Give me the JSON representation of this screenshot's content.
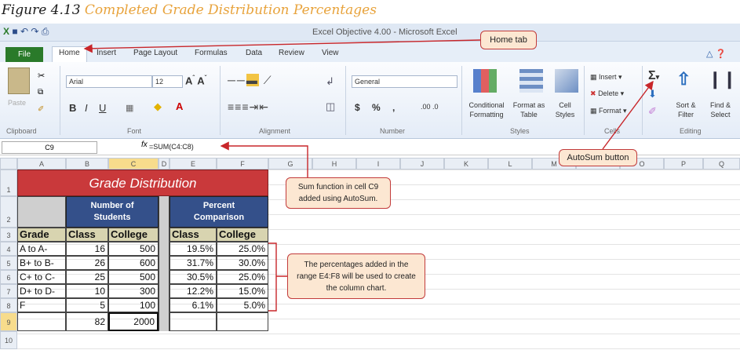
{
  "figure": {
    "label": "Figure 4.13",
    "caption": "Completed Grade Distribution Percentages"
  },
  "window": {
    "title": "Excel Objective 4.00 - Microsoft Excel"
  },
  "tabs": [
    "File",
    "Home",
    "Insert",
    "Page Layout",
    "Formulas",
    "Data",
    "Review",
    "View"
  ],
  "ribbon": {
    "clipboard": {
      "paste": "Paste",
      "group": "Clipboard"
    },
    "font": {
      "name": "Arial",
      "size": "12",
      "group": "Font"
    },
    "alignment": {
      "group": "Alignment"
    },
    "number": {
      "format": "General",
      "group": "Number"
    },
    "styles": {
      "conditional": "Conditional\nFormatting",
      "format_table": "Format as\nTable",
      "cell_styles": "Cell\nStyles",
      "group": "Styles"
    },
    "cells": {
      "insert": "Insert",
      "delete": "Delete",
      "format": "Format",
      "group": "Cells"
    },
    "editing": {
      "sort": "Sort &\nFilter",
      "find": "Find &\nSelect",
      "group": "Editing"
    }
  },
  "formula_bar": {
    "name_box": "C9",
    "fx": "fx",
    "formula": "=SUM(C4:C8)"
  },
  "columns": [
    "A",
    "B",
    "C",
    "D",
    "E",
    "F",
    "G",
    "H",
    "I",
    "J",
    "K",
    "L",
    "M",
    "N",
    "O",
    "P",
    "Q"
  ],
  "rows": [
    "1",
    "2",
    "3",
    "4",
    "5",
    "6",
    "7",
    "8",
    "9",
    "10"
  ],
  "sheet": {
    "title": "Grade Distribution",
    "num_students": "Number of\nStudents",
    "percent_comp": "Percent\nComparison",
    "grade_hdr": "Grade",
    "class_hdr": "Class",
    "college_hdr": "College",
    "class_hdr2": "Class",
    "college_hdr2": "College",
    "data": [
      {
        "grade": "A to A-",
        "class": "16",
        "college": "500",
        "pclass": "19.5%",
        "pcollege": "25.0%"
      },
      {
        "grade": "B+ to B-",
        "class": "26",
        "college": "600",
        "pclass": "31.7%",
        "pcollege": "30.0%"
      },
      {
        "grade": "C+ to C-",
        "class": "25",
        "college": "500",
        "pclass": "30.5%",
        "pcollege": "25.0%"
      },
      {
        "grade": "D+ to D-",
        "class": "10",
        "college": "300",
        "pclass": "12.2%",
        "pcollege": "15.0%"
      },
      {
        "grade": "F",
        "class": "5",
        "college": "100",
        "pclass": "6.1%",
        "pcollege": "5.0%"
      }
    ],
    "total_class": "82",
    "total_college": "2000"
  },
  "callouts": {
    "home_tab": "Home tab",
    "autosum": "AutoSum button",
    "sum_function": "Sum function in cell C9 added using AutoSum.",
    "percentages": "The percentages added in the range E4:F8 will be used to create the column chart."
  }
}
